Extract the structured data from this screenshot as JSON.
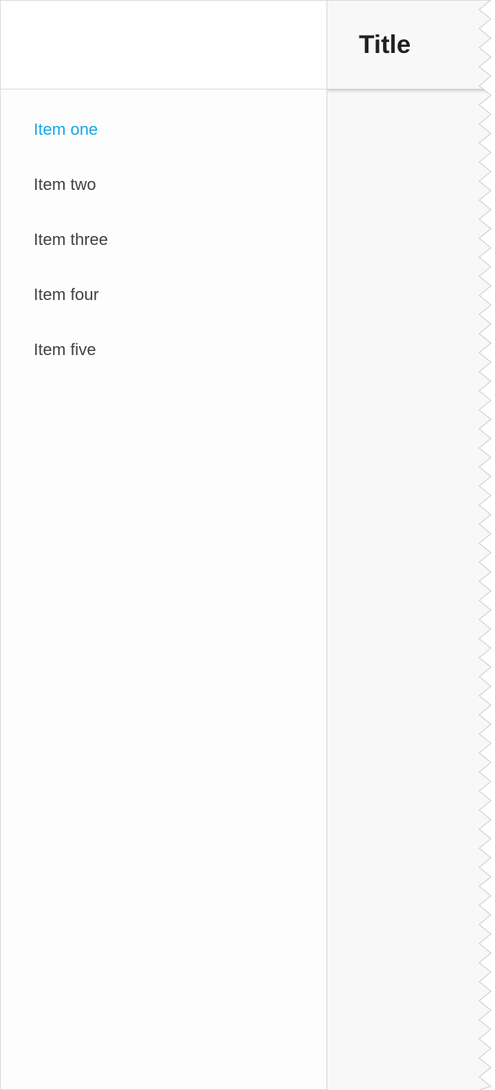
{
  "main": {
    "app_bar": {
      "title": "Title"
    }
  },
  "drawer": {
    "items": [
      {
        "label": "Item one",
        "active": true
      },
      {
        "label": "Item two",
        "active": false
      },
      {
        "label": "Item three",
        "active": false
      },
      {
        "label": "Item four",
        "active": false
      },
      {
        "label": "Item five",
        "active": false
      }
    ]
  },
  "colors": {
    "accent": "#16a8e6",
    "item_text": "#424242",
    "title_text": "#212121",
    "drawer_bg": "#fdfdfd",
    "main_bg": "#f8f8f8",
    "divider": "#d6d6d6"
  }
}
